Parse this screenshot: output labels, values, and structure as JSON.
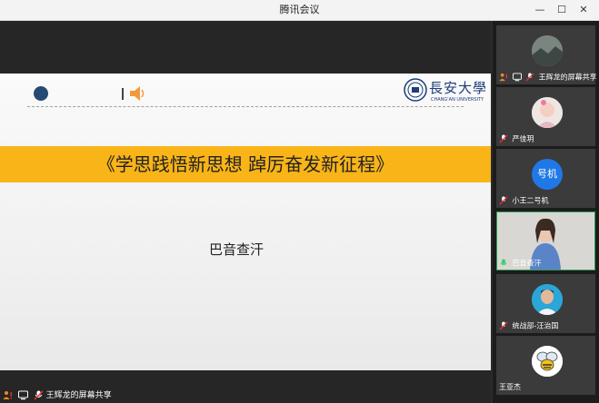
{
  "window": {
    "title": "腾讯会议",
    "minimize": "—",
    "maximize": "☐",
    "close": "✕"
  },
  "slide": {
    "title": "《学思践悟新思想  踔厉奋发新征程》",
    "presenter": "巴音查汗",
    "logo_cn": "長安大學",
    "logo_en": "CHANG'AN UNIVERSITY"
  },
  "footer": {
    "share_label": "王辉龙的屏幕共享"
  },
  "participants": [
    {
      "name": "王辉龙的屏幕共享",
      "avatar": "gray-photo"
    },
    {
      "name": "严佳玥",
      "avatar": "child-photo"
    },
    {
      "name": "小王二号机",
      "avatar": "text",
      "avatar_text": "号机"
    },
    {
      "name": "巴音查汗",
      "avatar": "video",
      "speaking": true
    },
    {
      "name": "统战部-汪治国",
      "avatar": "man-photo"
    },
    {
      "name": "王亚杰",
      "avatar": "bee-icon"
    }
  ],
  "colors": {
    "banner": "#f9b417",
    "accent_blue": "#1f78e6",
    "active_border": "#2f9e55"
  }
}
